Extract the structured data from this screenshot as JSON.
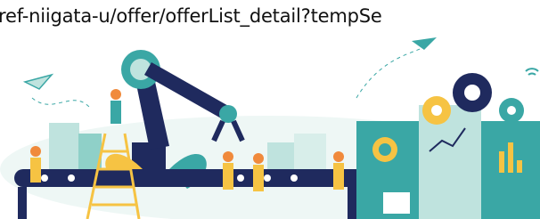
{
  "address_bar": {
    "url_text": "ref-niigata-u/offer/offerList_detail?tempSe"
  },
  "illustration": {
    "subject": "factory-automation-illustration",
    "colors": {
      "navy": "#1f2a5e",
      "teal": "#3aa7a5",
      "light_teal": "#bfe3de",
      "yellow": "#f6c343",
      "orange": "#f08a3c",
      "pale_bg": "#e8f4f2"
    }
  }
}
